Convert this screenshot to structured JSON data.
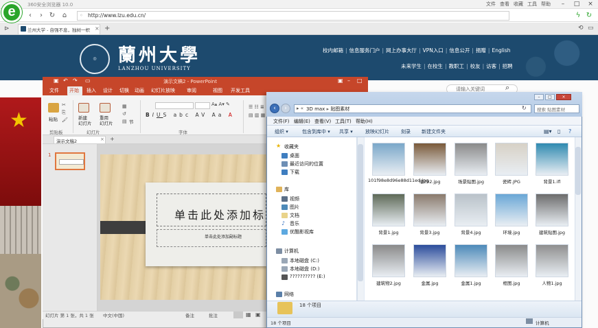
{
  "browser": {
    "app_title": "360安全浏览器 10.0",
    "menu": [
      "文件",
      "查看",
      "收藏",
      "工具",
      "帮助"
    ],
    "address": "http://www.lzu.edu.cn/",
    "tab_title": "兰州大学 - 自强不息，独树一帜"
  },
  "site": {
    "name_cn": "蘭州大學",
    "name_en": "LANZHOU UNIVERSITY",
    "nav_row1": [
      "校内邮箱",
      "信息服务门户",
      "网上办事大厅",
      "VPN入口",
      "信息公开",
      "捐赠",
      "English"
    ],
    "nav_row2": [
      "未来学生",
      "在校生",
      "教职工",
      "校友",
      "访客",
      "招聘"
    ],
    "search_placeholder": "请输入关键词"
  },
  "ppt": {
    "title": "演示文稿2 - PowerPoint",
    "tabs": [
      "文件",
      "开始",
      "插入",
      "设计",
      "切换",
      "动画",
      "幻灯片放映",
      "审阅",
      "视图",
      "开发工具"
    ],
    "ribbon": {
      "paste": "粘贴",
      "new_slide": "新建\n幻灯片",
      "reuse_slide": "重用\n幻灯片",
      "section": "节",
      "group_clipboard": "剪贴板",
      "group_slides": "幻灯片",
      "group_font": "字体"
    },
    "doc_tab": "演示文稿2",
    "slide_number": "1",
    "slide_title": "单击此处添加标题",
    "slide_subtitle": "单击此处添加副标题",
    "status_left": "幻灯片 第 1 张，共 1 张",
    "status_lang": "中文(中国)",
    "status_notes": "备注",
    "status_comments": "批注"
  },
  "explorer": {
    "path": [
      "3D max",
      "贴图素材"
    ],
    "search_placeholder": "搜索 贴图素材",
    "menu": [
      "文件(F)",
      "编辑(E)",
      "查看(V)",
      "工具(T)",
      "帮助(H)"
    ],
    "toolbar": [
      "组织 ▾",
      "包含到库中 ▾",
      "共享 ▾",
      "放映幻灯片",
      "刻录",
      "新建文件夹"
    ],
    "nav": {
      "favorites": "收藏夹",
      "fav_items": [
        "桌面",
        "最近访问的位置",
        "下载"
      ],
      "libraries": "库",
      "lib_items": [
        "视频",
        "图片",
        "文档",
        "音乐",
        "优酷影视库"
      ],
      "computer": "计算机",
      "comp_items": [
        "本地磁盘 (C:)",
        "本地磁盘 (D:)",
        "?????????? (E:)"
      ],
      "network": "网络"
    },
    "files": [
      {
        "name": "101f98e8d96e88d11ed.jpg",
        "color": "#7aa7c9"
      },
      {
        "name": "墙292.jpg",
        "color": "#7a5a3a"
      },
      {
        "name": "场景贴图.jpg",
        "color": "#8a8a8a"
      },
      {
        "name": "瓷砖.JPG",
        "color": "#d7d1c6"
      },
      {
        "name": "背景1.ifl",
        "color": "#2f8ab0"
      },
      {
        "name": "背景1.jpg",
        "color": "#5f6a58"
      },
      {
        "name": "背景3.jpg",
        "color": "#8a7a6c"
      },
      {
        "name": "背景4.jpg",
        "color": "#b9c2c9"
      },
      {
        "name": "环境.jpg",
        "color": "#6aa7d6"
      },
      {
        "name": "建筑贴图.jpg",
        "color": "#6c6c6c"
      },
      {
        "name": "建筑物2.jpg",
        "color": "#8a8a8a"
      },
      {
        "name": "金属.jpg",
        "color": "#2c4d9c"
      },
      {
        "name": "金属1.jpg",
        "color": "#4d8ab9"
      },
      {
        "name": "框图.jpg",
        "color": "#8b8b8b"
      },
      {
        "name": "人物1.jpg",
        "color": "#8f8f8f"
      }
    ],
    "item_count": "18 个项目",
    "status": "18 个项目",
    "status_right": "计算机"
  }
}
